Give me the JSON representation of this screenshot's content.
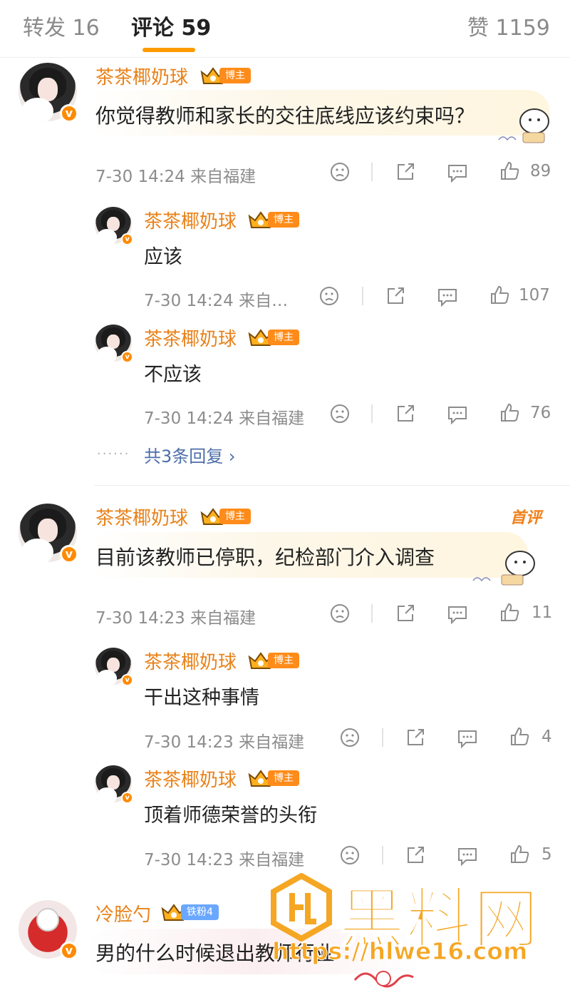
{
  "tabs": [
    {
      "label": "转发 16"
    },
    {
      "label": "评论 59"
    },
    {
      "label": "赞 1159"
    }
  ],
  "comments": [
    {
      "user": "茶茶椰奶球",
      "tag": "博主",
      "text": "你觉得教师和家长的交往底线应该约束吗？",
      "meta": "7-30 14:24 来自福建",
      "likes": "89",
      "replies": [
        {
          "user": "茶茶椰奶球",
          "tag": "博主",
          "text": "应该",
          "meta": "7-30 14:24 来自…",
          "likes": "107"
        },
        {
          "user": "茶茶椰奶球",
          "tag": "博主",
          "text": "不应该",
          "meta": "7-30 14:24 来自福建",
          "likes": "76"
        }
      ],
      "more_dots": "······",
      "more": "共3条回复 ›"
    },
    {
      "user": "茶茶椰奶球",
      "tag": "博主",
      "pinned": "首评",
      "text": "目前该教师已停职，纪检部门介入调查",
      "meta": "7-30 14:23 来自福建",
      "likes": "11",
      "replies": [
        {
          "user": "茶茶椰奶球",
          "tag": "博主",
          "text": "干出这种事情",
          "meta": "7-30 14:23 来自福建",
          "likes": "4"
        },
        {
          "user": "茶茶椰奶球",
          "tag": "博主",
          "text": "顶着师德荣誉的头衔",
          "meta": "7-30 14:23 来自福建",
          "likes": "5"
        }
      ]
    },
    {
      "user": "冷脸勺",
      "tag": "铁粉4",
      "text": "男的什么时候退出教师行业"
    }
  ],
  "watermark": {
    "brand": "黑料网",
    "url": "https://hlwe16.com"
  },
  "colors": {
    "accent": "#ff9a00",
    "username": "#e8821a",
    "link": "#4c6ea8",
    "meta": "#8c8c8c"
  }
}
